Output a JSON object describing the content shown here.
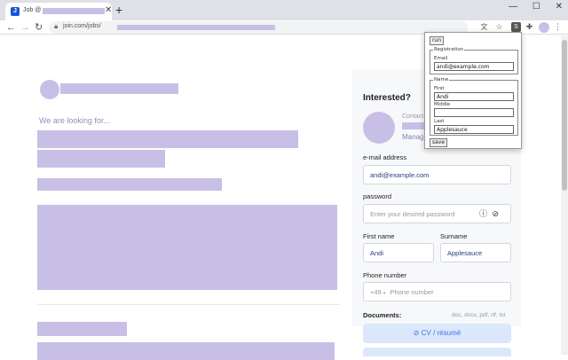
{
  "browser": {
    "tab_title": "Job @",
    "tab_favicon": "J",
    "url": "join.com/jobs/",
    "icons": [
      "back-icon",
      "forward-icon",
      "reload-icon",
      "lock-icon",
      "translate-icon",
      "star-icon",
      "extension-icon",
      "puzzle-icon",
      "menu-icon"
    ]
  },
  "page": {
    "looking_for": "We are looking for...",
    "apply": {
      "heading": "Interested?",
      "contact_label": "Contact",
      "contact_role": "Manag",
      "email_label": "e-mail address",
      "email_value": "andi@example.com",
      "password_label": "password",
      "password_placeholder": "Enter your desired password",
      "first_name_label": "First name",
      "first_name_value": "Andi",
      "surname_label": "Surname",
      "surname_value": "Applesauce",
      "phone_label": "Phone number",
      "phone_prefix": "+49",
      "phone_placeholder": "Phone number",
      "documents_label": "Documents:",
      "documents_hint": "doc, docx, pdf, rtf, txt",
      "cv_button": "CV / résumé"
    }
  },
  "popup": {
    "run_label": "run",
    "registration_legend": "Registration",
    "email_label": "Email",
    "email_value": "andi@example.com",
    "name_legend": "Name",
    "first_label": "First",
    "first_value": "Andi",
    "middle_label": "Middle",
    "middle_value": "",
    "last_label": "Last",
    "last_value": "Applesauce",
    "save_label": "save"
  },
  "colors": {
    "redaction": "#c8bfe7",
    "accent": "#4a6fdc",
    "panel_bg": "#f7f8fa"
  }
}
